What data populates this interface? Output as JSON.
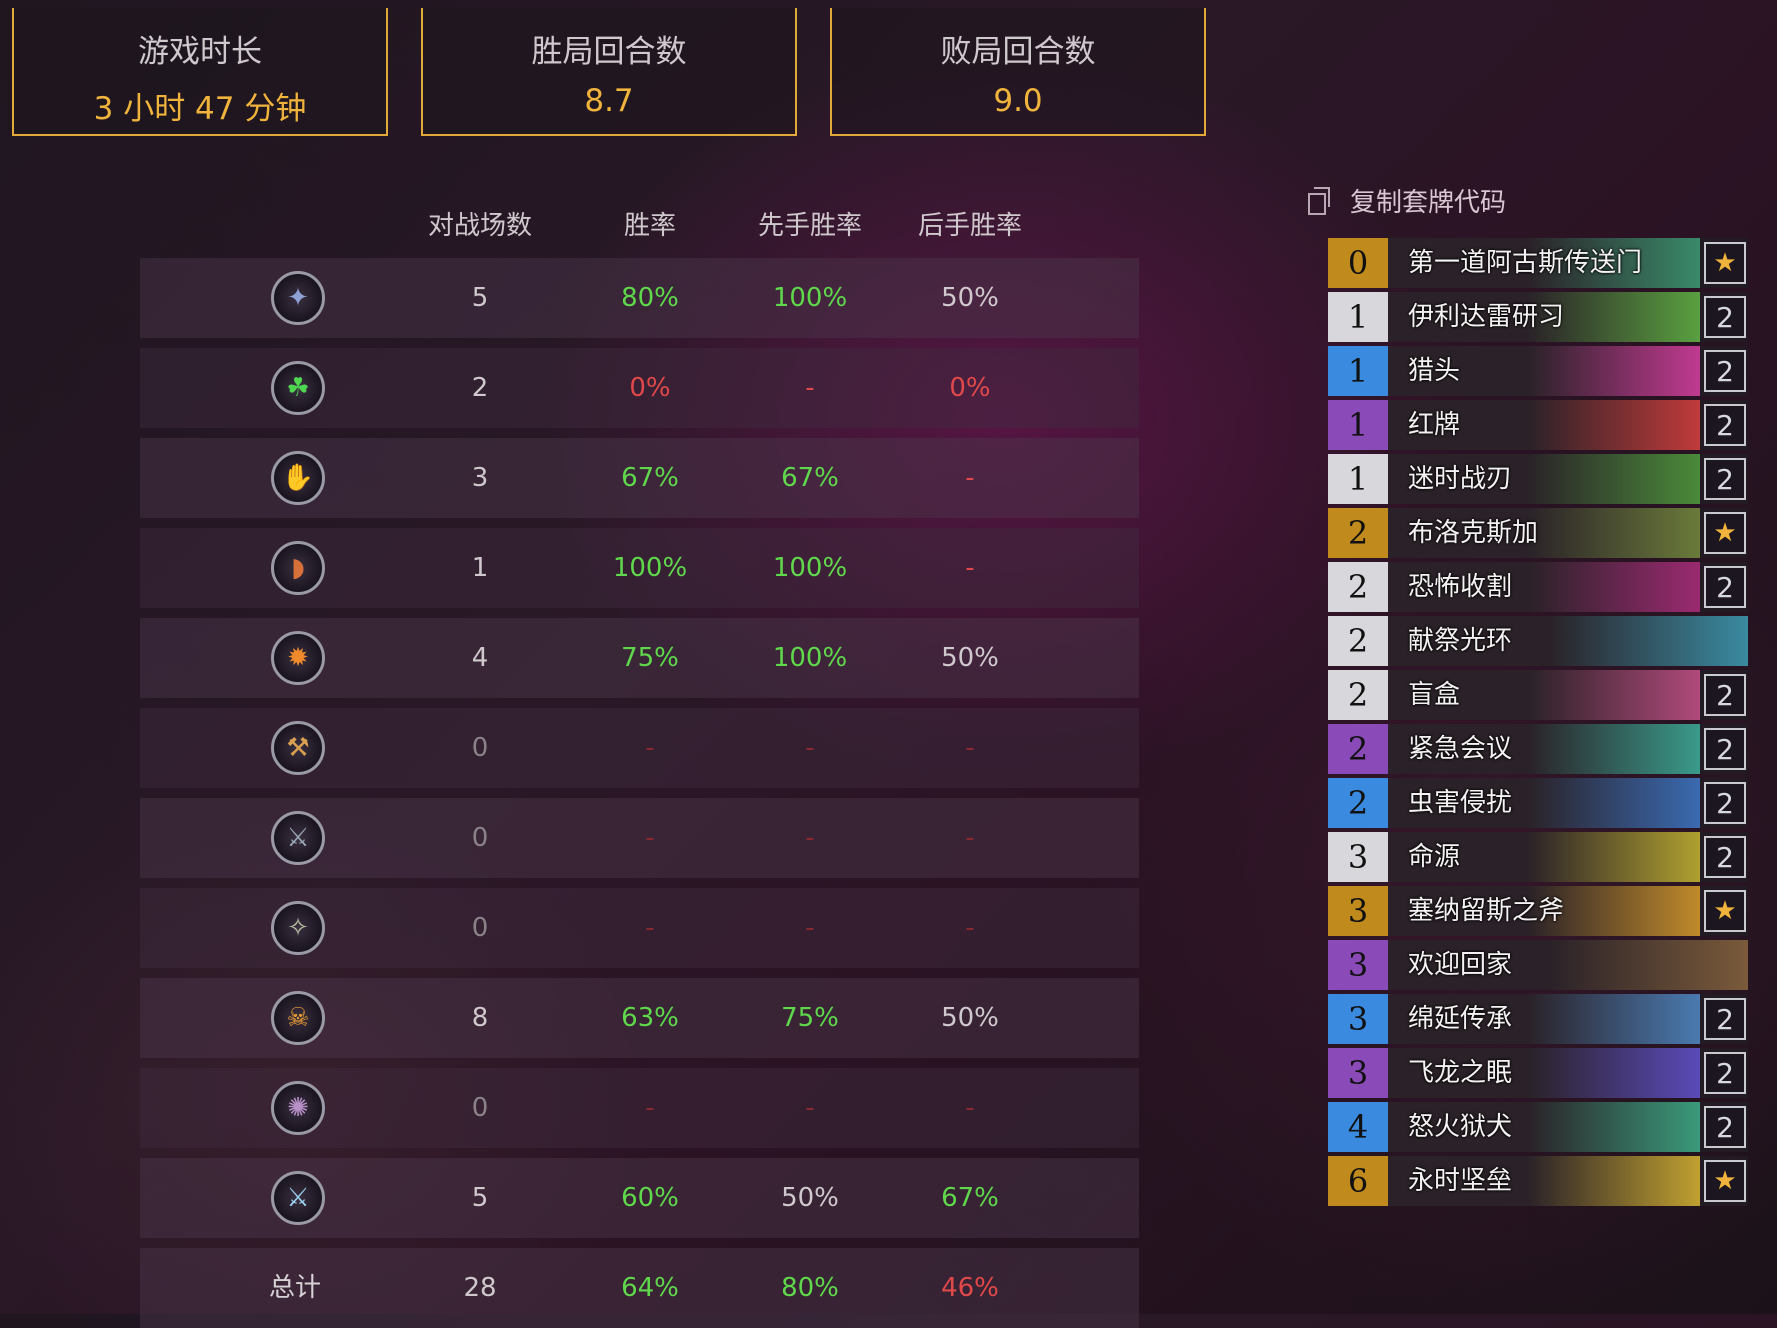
{
  "summary": [
    {
      "label": "游戏时长",
      "value": "3 小时 47 分钟"
    },
    {
      "label": "胜局回合数",
      "value": "8.7"
    },
    {
      "label": "败局回合数",
      "value": "9.0"
    }
  ],
  "table": {
    "headers": {
      "games": "对战场数",
      "winrate": "胜率",
      "first": "先手胜率",
      "second": "后手胜率"
    },
    "rows": [
      {
        "icon": "mage-class-icon",
        "glyph": "✦",
        "glyph_color": "#8fa2d8",
        "games": "5",
        "winrate": "80%",
        "first": "100%",
        "second": "50%",
        "wr_color": "#5fd84b",
        "first_color": "#5fd84b",
        "second_color": "#cfc8cc"
      },
      {
        "icon": "shaman-class-icon",
        "glyph": "☘",
        "glyph_color": "#4fd650",
        "games": "2",
        "winrate": "0%",
        "first": "-",
        "second": "0%",
        "wr_color": "#e0484a",
        "first_color": "#e0484a",
        "second_color": "#e0484a"
      },
      {
        "icon": "druid-class-icon",
        "glyph": "✋",
        "glyph_color": "#8fc6d8",
        "games": "3",
        "winrate": "67%",
        "first": "67%",
        "second": "-",
        "wr_color": "#5fd84b",
        "first_color": "#5fd84b",
        "second_color": "#e0484a"
      },
      {
        "icon": "hunter-class-icon",
        "glyph": "◗",
        "glyph_color": "#d8703a",
        "games": "1",
        "winrate": "100%",
        "first": "100%",
        "second": "-",
        "wr_color": "#5fd84b",
        "first_color": "#5fd84b",
        "second_color": "#e0484a"
      },
      {
        "icon": "warlock-class-icon",
        "glyph": "✹",
        "glyph_color": "#f08a2a",
        "games": "4",
        "winrate": "75%",
        "first": "100%",
        "second": "50%",
        "wr_color": "#5fd84b",
        "first_color": "#5fd84b",
        "second_color": "#cfc8cc"
      },
      {
        "icon": "paladin-class-icon",
        "glyph": "⚒",
        "glyph_color": "#d8a050",
        "games": "0",
        "winrate": "-",
        "first": "-",
        "second": "-",
        "wr_color": "#8a2a30",
        "first_color": "#8a2a30",
        "second_color": "#8a2a30"
      },
      {
        "icon": "warrior-class-icon",
        "glyph": "⚔",
        "glyph_color": "#9aa8b8",
        "games": "0",
        "winrate": "-",
        "first": "-",
        "second": "-",
        "wr_color": "#8a2a30",
        "first_color": "#8a2a30",
        "second_color": "#8a2a30"
      },
      {
        "icon": "rogue-class-icon",
        "glyph": "✧",
        "glyph_color": "#b8c0a0",
        "games": "0",
        "winrate": "-",
        "first": "-",
        "second": "-",
        "wr_color": "#8a2a30",
        "first_color": "#8a2a30",
        "second_color": "#8a2a30"
      },
      {
        "icon": "demon-hunter-class-icon",
        "glyph": "☠",
        "glyph_color": "#f0a030",
        "games": "8",
        "winrate": "63%",
        "first": "75%",
        "second": "50%",
        "wr_color": "#5fd84b",
        "first_color": "#5fd84b",
        "second_color": "#cfc8cc"
      },
      {
        "icon": "priest-class-icon",
        "glyph": "✺",
        "glyph_color": "#b890c8",
        "games": "0",
        "winrate": "-",
        "first": "-",
        "second": "-",
        "wr_color": "#8a2a30",
        "first_color": "#8a2a30",
        "second_color": "#8a2a30"
      },
      {
        "icon": "death-knight-class-icon",
        "glyph": "⚔",
        "glyph_color": "#9ad0f0",
        "games": "5",
        "winrate": "60%",
        "first": "50%",
        "second": "67%",
        "wr_color": "#5fd84b",
        "first_color": "#cfc8cc",
        "second_color": "#5fd84b"
      }
    ],
    "total": {
      "label": "总计",
      "games": "28",
      "winrate": "64%",
      "first": "80%",
      "second": "46%",
      "wr_color": "#5fd84b",
      "first_color": "#5fd84b",
      "second_color": "#e0484a"
    }
  },
  "deck": {
    "copy_label": "复制套牌代码",
    "cards": [
      {
        "cost": "0",
        "name": "第一道阿古斯传送门",
        "count": "★",
        "legendary": true,
        "cost_bg": "#c08a1c",
        "art": "#3a8a6a"
      },
      {
        "cost": "1",
        "name": "伊利达雷研习",
        "count": "2",
        "legendary": false,
        "cost_bg": "#d8d8dc",
        "art": "#5aa040"
      },
      {
        "cost": "1",
        "name": "猎头",
        "count": "2",
        "legendary": false,
        "cost_bg": "#3a8ae0",
        "art": "#c03a90"
      },
      {
        "cost": "1",
        "name": "红牌",
        "count": "2",
        "legendary": false,
        "cost_bg": "#8a4ab8",
        "art": "#c03a3a"
      },
      {
        "cost": "1",
        "name": "迷时战刃",
        "count": "2",
        "legendary": false,
        "cost_bg": "#d8d8dc",
        "art": "#4a8a3a"
      },
      {
        "cost": "2",
        "name": "布洛克斯加",
        "count": "★",
        "legendary": true,
        "cost_bg": "#c08a1c",
        "art": "#6a7a3a"
      },
      {
        "cost": "2",
        "name": "恐怖收割",
        "count": "2",
        "legendary": false,
        "cost_bg": "#d8d8dc",
        "art": "#9a2a70"
      },
      {
        "cost": "2",
        "name": "献祭光环",
        "count": "",
        "legendary": false,
        "cost_bg": "#d8d8dc",
        "art": "#3a8aa0"
      },
      {
        "cost": "2",
        "name": "盲盒",
        "count": "2",
        "legendary": false,
        "cost_bg": "#d8d8dc",
        "art": "#b04a7a"
      },
      {
        "cost": "2",
        "name": "紧急会议",
        "count": "2",
        "legendary": false,
        "cost_bg": "#8a4ab8",
        "art": "#3a9a8a"
      },
      {
        "cost": "2",
        "name": "虫害侵扰",
        "count": "2",
        "legendary": false,
        "cost_bg": "#3a8ae0",
        "art": "#3a6ab0"
      },
      {
        "cost": "3",
        "name": "命源",
        "count": "2",
        "legendary": false,
        "cost_bg": "#d8d8dc",
        "art": "#b0a030"
      },
      {
        "cost": "3",
        "name": "塞纳留斯之斧",
        "count": "★",
        "legendary": true,
        "cost_bg": "#c08a1c",
        "art": "#c08a2a"
      },
      {
        "cost": "3",
        "name": "欢迎回家",
        "count": "",
        "legendary": false,
        "cost_bg": "#8a4ab8",
        "art": "#7a5a3a"
      },
      {
        "cost": "3",
        "name": "绵延传承",
        "count": "2",
        "legendary": false,
        "cost_bg": "#3a8ae0",
        "art": "#4a7ab0"
      },
      {
        "cost": "3",
        "name": "飞龙之眠",
        "count": "2",
        "legendary": false,
        "cost_bg": "#8a4ab8",
        "art": "#5a4ab8"
      },
      {
        "cost": "4",
        "name": "怒火狱犬",
        "count": "2",
        "legendary": false,
        "cost_bg": "#3a8ae0",
        "art": "#3a9a7a"
      },
      {
        "cost": "6",
        "name": "永时坚垒",
        "count": "★",
        "legendary": true,
        "cost_bg": "#c08a1c",
        "art": "#c0a030"
      }
    ]
  }
}
